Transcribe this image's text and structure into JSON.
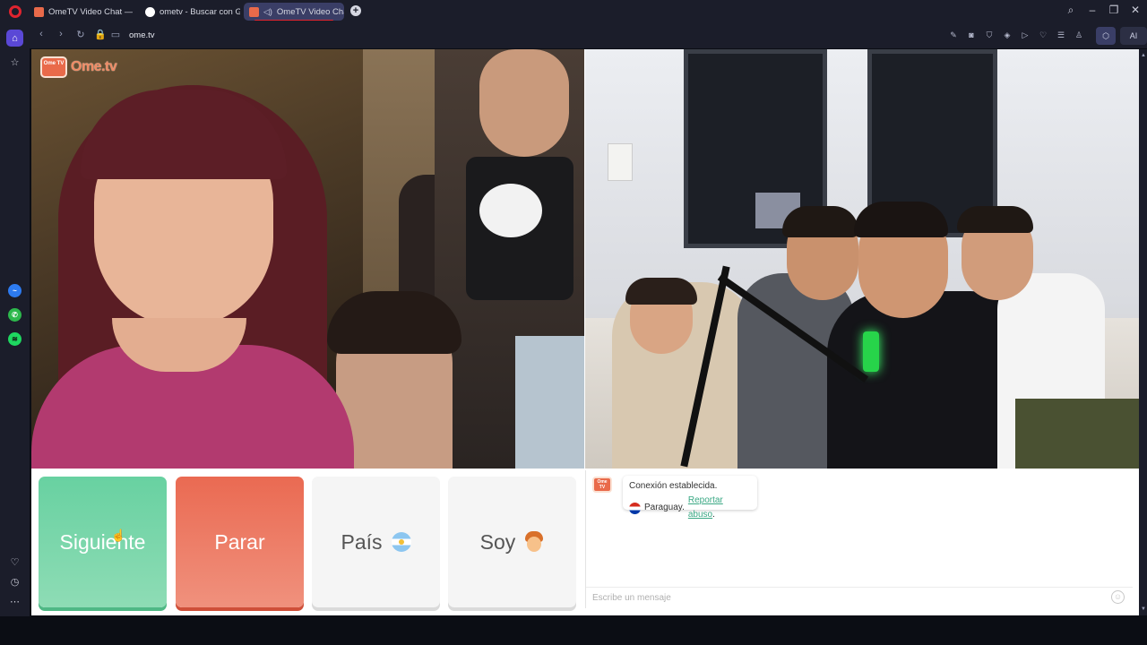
{
  "tabs": [
    {
      "label": "OmeTV Video Chat — Ome",
      "favicon_color": "#e96a4a"
    },
    {
      "label": "ometv - Buscar con Google",
      "favicon_color": "#ffffff"
    },
    {
      "label": "OmeTV Video Chat —",
      "favicon_color": "#e96a4a",
      "active": true
    }
  ],
  "address": {
    "url": "ome.tv"
  },
  "logo": {
    "small": "Ome TV",
    "word": "Ome.tv"
  },
  "buttons": {
    "next": "Siguiente",
    "stop": "Parar",
    "country": "País",
    "gender": "Soy"
  },
  "chat": {
    "badge": "Ome TV",
    "connection": "Conexión establecida.",
    "country": "Paraguay.",
    "report": "Reportar abuso",
    "report_suffix": ".",
    "placeholder": "Escribe un mensaje"
  },
  "sidebar_icons": [
    "home-icon",
    "star-icon",
    "messenger-icon",
    "whatsapp-icon",
    "spotify-icon",
    "heart-icon",
    "clock-icon",
    "more-icon"
  ],
  "colors": {
    "next": "#68d1a1",
    "stop": "#ea6a52",
    "accent": "#3aa884",
    "opera_red": "#e0242f"
  },
  "toolbar": {
    "ai_label": "AI"
  }
}
